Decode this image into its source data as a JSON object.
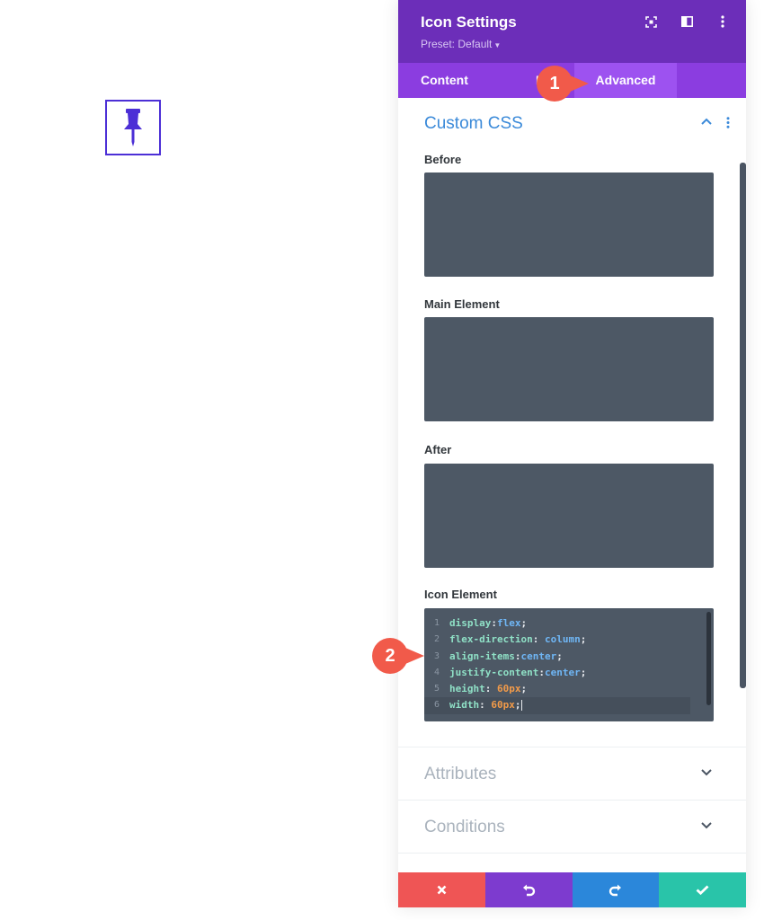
{
  "canvas": {
    "icon": "pushpin-icon",
    "icon_color": "#4c2fd6"
  },
  "panel": {
    "title": "Icon Settings",
    "preset": "Preset: Default",
    "header_icons": [
      "focus-icon",
      "split-view-icon",
      "more-vertical-icon"
    ],
    "tabs": [
      {
        "label": "Content"
      },
      {
        "label": "Design"
      },
      {
        "label": "Advanced",
        "active": true
      }
    ],
    "section": {
      "title": "Custom CSS",
      "fields": [
        {
          "label": "Before",
          "value": ""
        },
        {
          "label": "Main Element",
          "value": ""
        },
        {
          "label": "After",
          "value": ""
        },
        {
          "label": "Icon Element"
        }
      ]
    },
    "code_lines": [
      {
        "n": "1",
        "prop": "display",
        "sep": ":",
        "val": "flex",
        "unit_val": false
      },
      {
        "n": "2",
        "prop": "flex-direction",
        "sep": ": ",
        "val": "column",
        "unit_val": false
      },
      {
        "n": "3",
        "prop": "align-items",
        "sep": ":",
        "val": "center",
        "unit_val": false
      },
      {
        "n": "4",
        "prop": "justify-content",
        "sep": ":",
        "val": "center",
        "unit_val": false
      },
      {
        "n": "5",
        "prop": "height",
        "sep": ": ",
        "val": "60px",
        "unit_val": true
      },
      {
        "n": "6",
        "prop": "width",
        "sep": ": ",
        "val": "60px",
        "unit_val": true
      }
    ],
    "collapsed_sections": [
      {
        "title": "Attributes"
      },
      {
        "title": "Conditions"
      }
    ],
    "footer": [
      "cancel-icon",
      "undo-icon",
      "redo-icon",
      "save-check-icon"
    ]
  },
  "annotations": [
    {
      "number": "1"
    },
    {
      "number": "2"
    }
  ],
  "colors": {
    "header": "#6c2eb9",
    "tabs": "#8b3de0",
    "active_tab": "#9d52f0",
    "section_title": "#3b8ad9",
    "code_bg": "#4d5865",
    "cancel": "#ef5555",
    "undo": "#7d3bcf",
    "redo": "#2b87da",
    "save": "#29c4a9",
    "badge": "#f15a4a"
  }
}
